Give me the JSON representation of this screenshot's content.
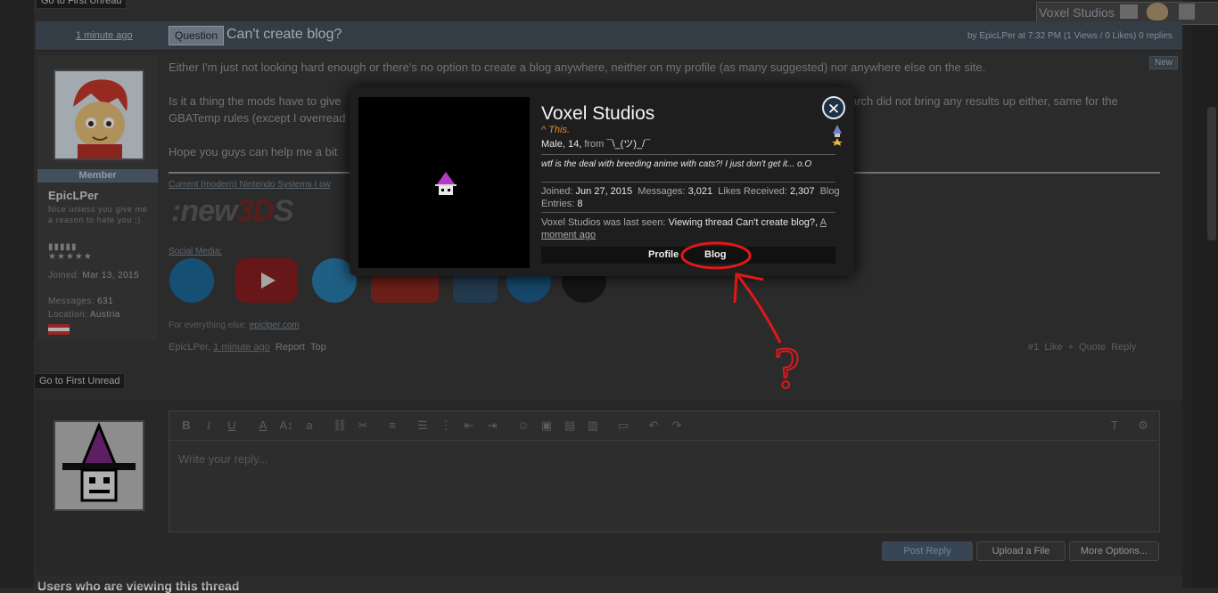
{
  "top_bar": {
    "go_first_label": "Go to First Unread"
  },
  "top_right_user": {
    "name": "Voxel Studios"
  },
  "thread": {
    "time": "1 minute ago",
    "badge": "Question",
    "title": "Can't create blog?",
    "meta": "by EpicLPer at 7:32 PM (1 Views / 0 Likes) 0 replies",
    "new_badge": "New"
  },
  "poster": {
    "rank": "Member",
    "name": "EpicLPer",
    "custom_title": "Nice unless you give me a reason to hate you ;)",
    "joined_label": "Joined:",
    "joined": "Mar 13, 2015",
    "messages_label": "Messages:",
    "messages": "631",
    "location_label": "Location:",
    "location": "Austria"
  },
  "post": {
    "para1": "Either I'm just not looking hard enough or there's no option to create a blog anywhere, neither on my profile (as many suggested) nor anywhere else on the site.",
    "para2": "Is it a thing the mods have to give",
    "para2_tail": "he there from the beginning on? A quick Google search did not bring any results up either, same for the",
    "para2_line2": "GBATemp rules (except I overread",
    "para3": "Hope you guys can help me a bit",
    "sig_systems": "Current (modern) Nintendo Systems I ow",
    "sig_social": "Social Media:",
    "sig_else": "For everything else:",
    "sig_site": "epiclper.com",
    "foot_author": "EpicLPer,",
    "foot_time": "1 minute ago",
    "foot_report": "Report",
    "foot_top": "Top",
    "foot_num": "#1",
    "foot_like": "Like",
    "foot_quote": "+ Quote",
    "foot_reply": "Reply"
  },
  "reply": {
    "go_first_label": "Go to First Unread",
    "placeholder": "Write your reply...",
    "post_reply": "Post Reply",
    "upload": "Upload a File",
    "more": "More Options...",
    "users_viewing": "Users who are viewing this thread"
  },
  "member_card": {
    "name": "Voxel Studios",
    "status": "^ This.",
    "gender_age": "Male, 14,",
    "from_label": "from",
    "from": "¯\\_(ツ)_/¯",
    "quote": "wtf is the deal with breeding anime with cats?! I just don't get it... o.O",
    "joined_label": "Joined:",
    "joined": "Jun 27, 2015",
    "messages_label": "Messages:",
    "messages": "3,021",
    "likes_label": "Likes Received:",
    "likes": "2,307",
    "blog_label": "Blog Entries:",
    "blog": "8",
    "seen_label": "Voxel Studios was last seen:",
    "seen_activity": "Viewing thread Can't create blog?,",
    "seen_time": "A moment ago",
    "profile_link": "Profile",
    "blog_link": "Blog"
  },
  "annotation": {
    "mark": "?",
    "color": "#e01818"
  }
}
